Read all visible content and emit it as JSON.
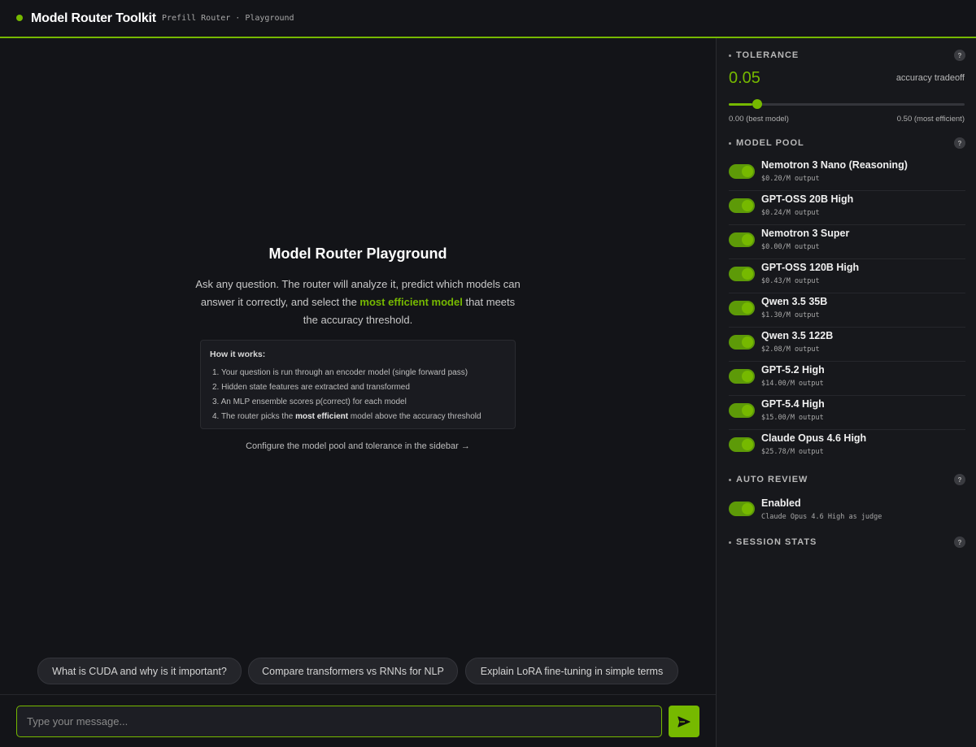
{
  "header": {
    "title": "Model Router Toolkit",
    "subtitle": "Prefill Router · Playground"
  },
  "welcome": {
    "title": "Model Router Playground",
    "desc_before": "Ask any question. The router will analyze it, predict which models can answer it correctly, and select the ",
    "desc_highlight": "most efficient model",
    "desc_after": " that meets the accuracy threshold.",
    "how_title": "How it works:",
    "steps": [
      "1. Your question is run through an encoder model (single forward pass)",
      "2. Hidden state features are extracted and transformed",
      "3. An MLP ensemble scores p(correct) for each model"
    ],
    "step4_before": "4. The router picks the ",
    "step4_bold": "most efficient",
    "step4_after": " model above the accuracy threshold",
    "config_hint": "Configure the model pool and tolerance in the sidebar →"
  },
  "suggestions": [
    "What is CUDA and why is it important?",
    "Compare transformers vs RNNs for NLP",
    "Explain LoRA fine-tuning in simple terms"
  ],
  "composer": {
    "placeholder": "Type your message...",
    "send_icon": "send-arrow-icon"
  },
  "sidebar": {
    "tolerance": {
      "title": "TOLERANCE",
      "value": "0.05",
      "value_fraction": 0.1,
      "caption": "accuracy tradeoff",
      "min_label": "0.00 (best model)",
      "max_label": "0.50 (most efficient)"
    },
    "model_pool": {
      "title": "MODEL POOL",
      "models": [
        {
          "name": "Nemotron 3 Nano (Reasoning)",
          "price": "$0.20/M output",
          "enabled": true
        },
        {
          "name": "GPT-OSS 20B High",
          "price": "$0.24/M output",
          "enabled": true
        },
        {
          "name": "Nemotron 3 Super",
          "price": "$0.00/M output",
          "enabled": true
        },
        {
          "name": "GPT-OSS 120B High",
          "price": "$0.43/M output",
          "enabled": true
        },
        {
          "name": "Qwen 3.5 35B",
          "price": "$1.30/M output",
          "enabled": true
        },
        {
          "name": "Qwen 3.5 122B",
          "price": "$2.08/M output",
          "enabled": true
        },
        {
          "name": "GPT-5.2 High",
          "price": "$14.00/M output",
          "enabled": true
        },
        {
          "name": "GPT-5.4 High",
          "price": "$15.00/M output",
          "enabled": true
        },
        {
          "name": "Claude Opus 4.6 High",
          "price": "$25.78/M output",
          "enabled": true
        }
      ]
    },
    "auto_review": {
      "title": "AUTO REVIEW",
      "label": "Enabled",
      "desc": "Claude Opus 4.6 High as judge",
      "enabled": true
    },
    "session_stats": {
      "title": "SESSION STATS"
    },
    "help_glyph": "?"
  },
  "colors": {
    "accent": "#76b900",
    "background": "#131418",
    "sidebar": "#17181c"
  }
}
